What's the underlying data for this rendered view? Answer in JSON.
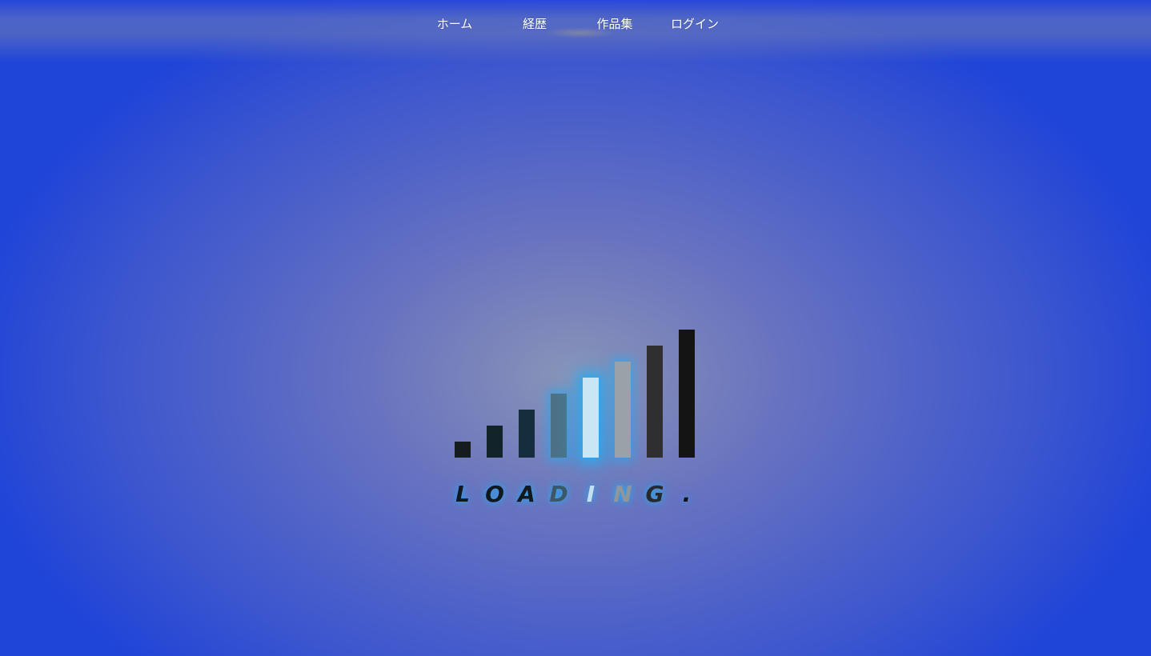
{
  "nav": {
    "items": [
      {
        "label": "ホーム"
      },
      {
        "label": "経歴"
      },
      {
        "label": "作品集"
      },
      {
        "label": "ログイン"
      }
    ]
  },
  "loader": {
    "bars": [
      {
        "color": "#141c1f",
        "glow": "none"
      },
      {
        "color": "#13232a",
        "glow": "none"
      },
      {
        "color": "#152d3c",
        "glow": "none"
      },
      {
        "color": "#4d7185",
        "glow": "half"
      },
      {
        "color": "#c9e6f4",
        "glow": "lit"
      },
      {
        "color": "#9aa1a8",
        "glow": "half"
      },
      {
        "color": "#2f2f31",
        "glow": "none"
      },
      {
        "color": "#141414",
        "glow": "none"
      }
    ],
    "letters": [
      {
        "char": "L",
        "color": "#101820"
      },
      {
        "char": "O",
        "color": "#101820"
      },
      {
        "char": "A",
        "color": "#101820"
      },
      {
        "char": "D",
        "color": "#3c5766"
      },
      {
        "char": "I",
        "color": "#c4dff0"
      },
      {
        "char": "N",
        "color": "#8f969c"
      },
      {
        "char": "G",
        "color": "#262a2e"
      },
      {
        "char": ".",
        "color": "#101010"
      }
    ]
  }
}
